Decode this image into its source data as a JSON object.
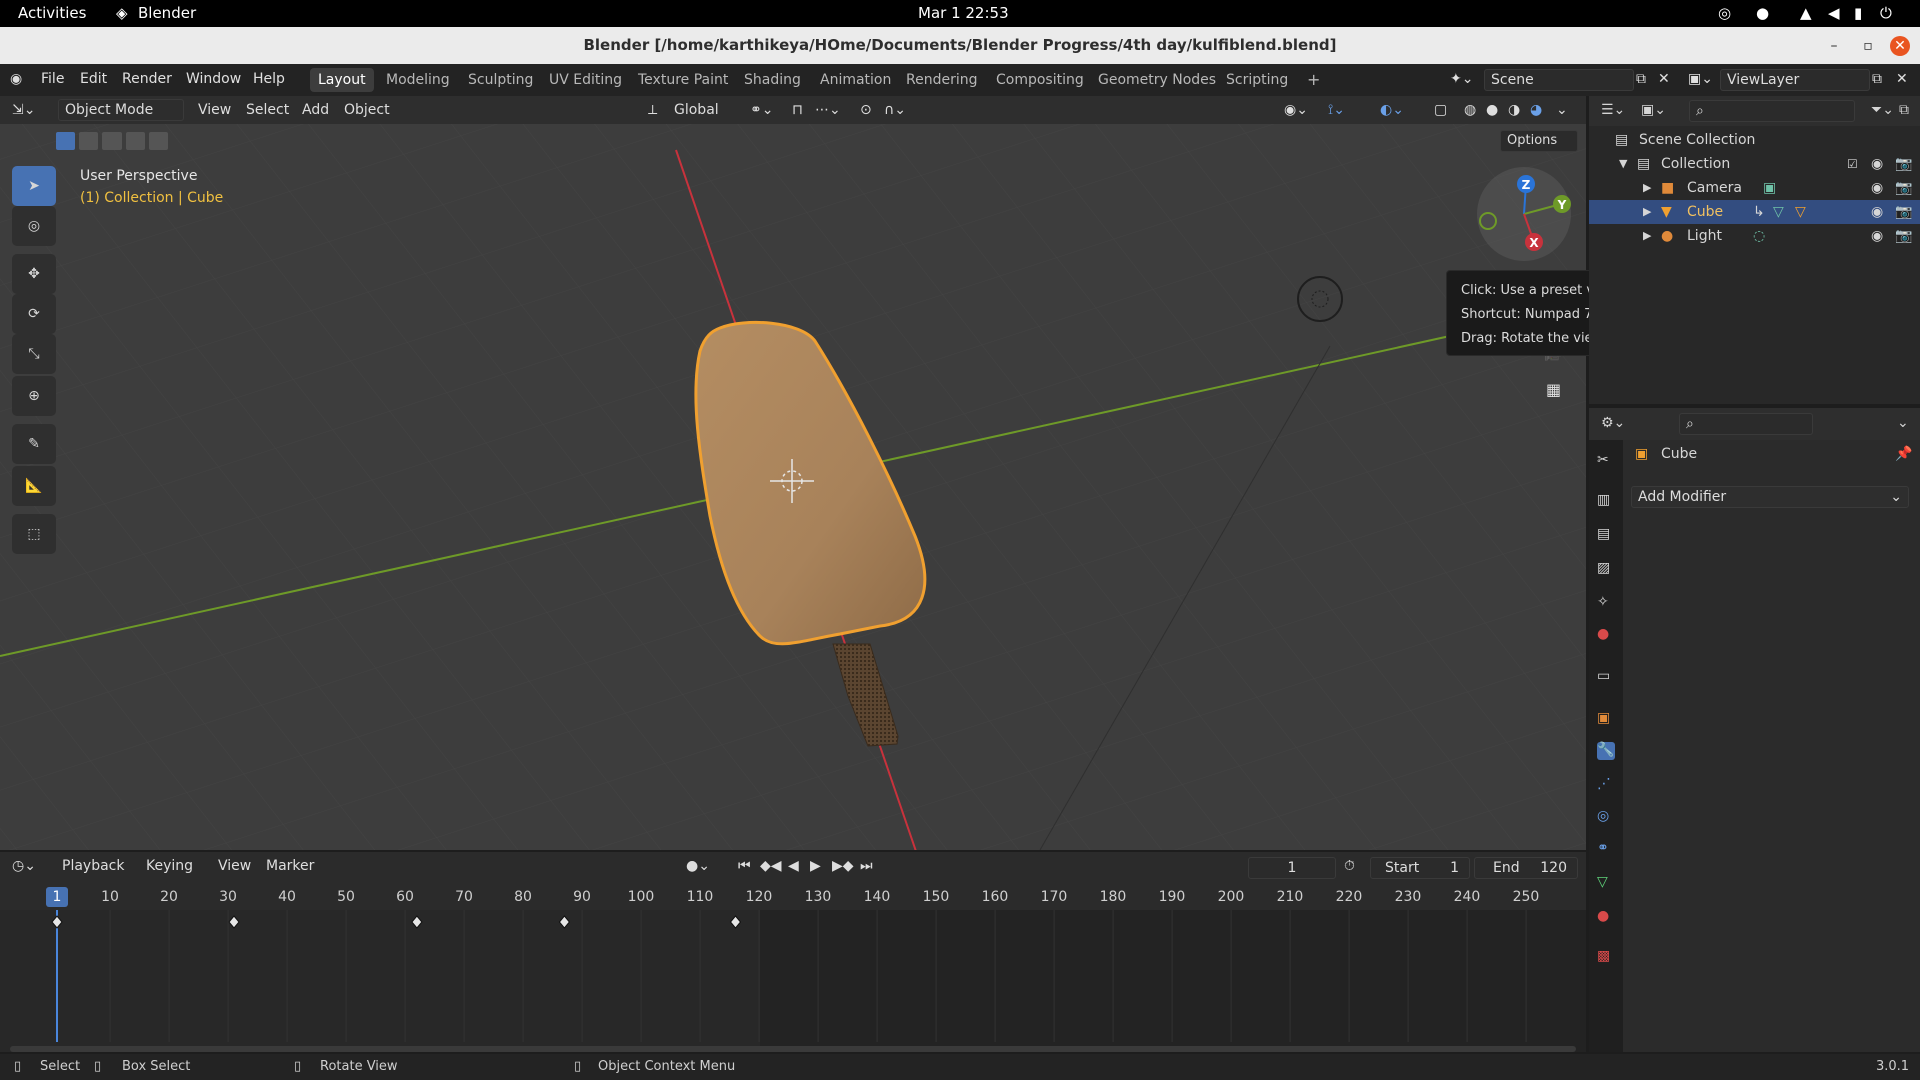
{
  "system_bar": {
    "activities": "Activities",
    "app": "Blender",
    "clock": "Mar 1  22:53"
  },
  "window": {
    "title": "Blender [/home/karthikeya/HOme/Documents/Blender Progress/4th day/kulfiblend.blend]"
  },
  "menu": {
    "file": "File",
    "edit": "Edit",
    "render": "Render",
    "window": "Window",
    "help": "Help"
  },
  "workspaces": [
    "Layout",
    "Modeling",
    "Sculpting",
    "UV Editing",
    "Texture Paint",
    "Shading",
    "Animation",
    "Rendering",
    "Compositing",
    "Geometry Nodes",
    "Scripting"
  ],
  "workspace_add": "+",
  "scene": {
    "name": "Scene",
    "view_layer": "ViewLayer"
  },
  "viewport_header": {
    "mode": "Object Mode",
    "view": "View",
    "select": "Select",
    "add": "Add",
    "object": "Object",
    "orientation": "Global",
    "options": "Options"
  },
  "viewport": {
    "perspective": "User Perspective",
    "context": "(1) Collection | Cube"
  },
  "gizmo": {
    "z": "Z",
    "y": "Y",
    "x": "X"
  },
  "tooltip": {
    "line1": "Click: Use a preset viewpoint",
    "line2": "Shortcut: Numpad 7",
    "line3": "Drag: Rotate the view"
  },
  "outliner": {
    "scene_collection": "Scene Collection",
    "collection": "Collection",
    "items": [
      "Camera",
      "Cube",
      "Light"
    ]
  },
  "properties": {
    "object_name": "Cube",
    "add_modifier": "Add Modifier"
  },
  "timeline": {
    "playback": "Playback",
    "keying": "Keying",
    "view": "View",
    "marker": "Marker",
    "current_frame": "1",
    "start_label": "Start",
    "start_value": "1",
    "end_label": "End",
    "end_value": "120",
    "ticks": [
      "10",
      "20",
      "30",
      "40",
      "50",
      "60",
      "70",
      "80",
      "90",
      "100",
      "110",
      "120",
      "130",
      "140",
      "150",
      "160",
      "170",
      "180",
      "190",
      "200",
      "210",
      "220",
      "230",
      "240",
      "250"
    ],
    "keyframes": [
      1,
      31,
      62,
      87,
      116
    ]
  },
  "status": {
    "select": "Select",
    "box_select": "Box Select",
    "rotate_view": "Rotate View",
    "context_menu": "Object Context Menu",
    "version": "3.0.1"
  },
  "colors": {
    "accent": "#4772b3",
    "selection": "#f0a030",
    "x_axis": "#c8323c",
    "y_axis": "#6e9a28",
    "z_axis": "#2a74d8"
  }
}
